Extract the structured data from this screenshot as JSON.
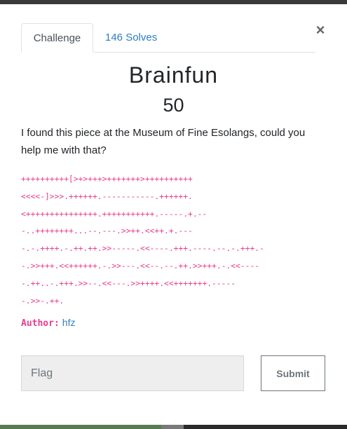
{
  "tabs": [
    {
      "label": "Challenge",
      "active": true
    },
    {
      "label": "146 Solves",
      "active": false
    }
  ],
  "close_icon": "×",
  "challenge": {
    "name": "Brainfun",
    "points": "50",
    "description": "I found this piece at the Museum of Fine Esolangs, could you help me with that?",
    "code_lines": [
      "++++++++++[>+>+++>+++++++>++++++++++",
      "<<<<-]>>>.++++++.-----------.++++++.",
      "<+++++++++++++++.+++++++++++.-----.+.--",
      "-..++++++++...--.---.>>++.<<++.+.---",
      "-.-.++++.-.++.++.>>-----.<<----.+++.----.--.-.+++.-",
      "-.>>+++.<<++++++.-.>>---.<<--.--.++.>>+++.-.<<----",
      "-.++..-.+++.>>--.<<---.>>++++.<<+++++++.-----",
      "-.>>-.++."
    ],
    "author_label": "Author:",
    "author": "hfz"
  },
  "form": {
    "flag_placeholder": "Flag",
    "submit_label": "Submit"
  }
}
